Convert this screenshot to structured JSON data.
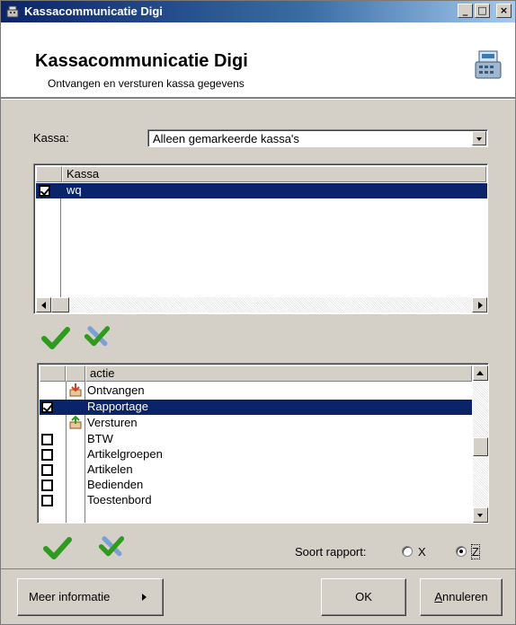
{
  "window": {
    "title": "Kassacommunicatie Digi",
    "title_buttons": [
      "_",
      "□",
      "×"
    ]
  },
  "header": {
    "title": "Kassacommunicatie Digi",
    "subtitle": "Ontvangen en versturen kassa gegevens",
    "icon": "cash-register-icon"
  },
  "kassa_filter": {
    "label": "Kassa:",
    "value": "Alleen gemarkeerde kassa's"
  },
  "kassa_grid": {
    "column": "Kassa",
    "rows": [
      {
        "checked": true,
        "name": "wq",
        "selected": true
      }
    ]
  },
  "kassa_actions": [
    "check-all-icon",
    "uncheck-all-icon"
  ],
  "actie_grid": {
    "column": "actie",
    "rows": [
      {
        "label": "Ontvangen",
        "checked": null,
        "icon": "receive-icon",
        "selected": false
      },
      {
        "label": "Rapportage",
        "checked": true,
        "icon": "",
        "selected": true
      },
      {
        "label": "Versturen",
        "checked": null,
        "icon": "send-icon",
        "selected": false
      },
      {
        "label": "BTW",
        "checked": false,
        "icon": "",
        "selected": false
      },
      {
        "label": "Artikelgroepen",
        "checked": false,
        "icon": "",
        "selected": false
      },
      {
        "label": "Artikelen",
        "checked": false,
        "icon": "",
        "selected": false
      },
      {
        "label": "Bedienden",
        "checked": false,
        "icon": "",
        "selected": false
      },
      {
        "label": "Toestenbord",
        "checked": false,
        "icon": "",
        "selected": false
      }
    ]
  },
  "report_type": {
    "label": "Soort rapport:",
    "options": [
      "X",
      "Z"
    ],
    "selected": "Z"
  },
  "footer": {
    "more_info": "Meer informatie",
    "ok": "OK",
    "cancel": "Annuleren"
  }
}
